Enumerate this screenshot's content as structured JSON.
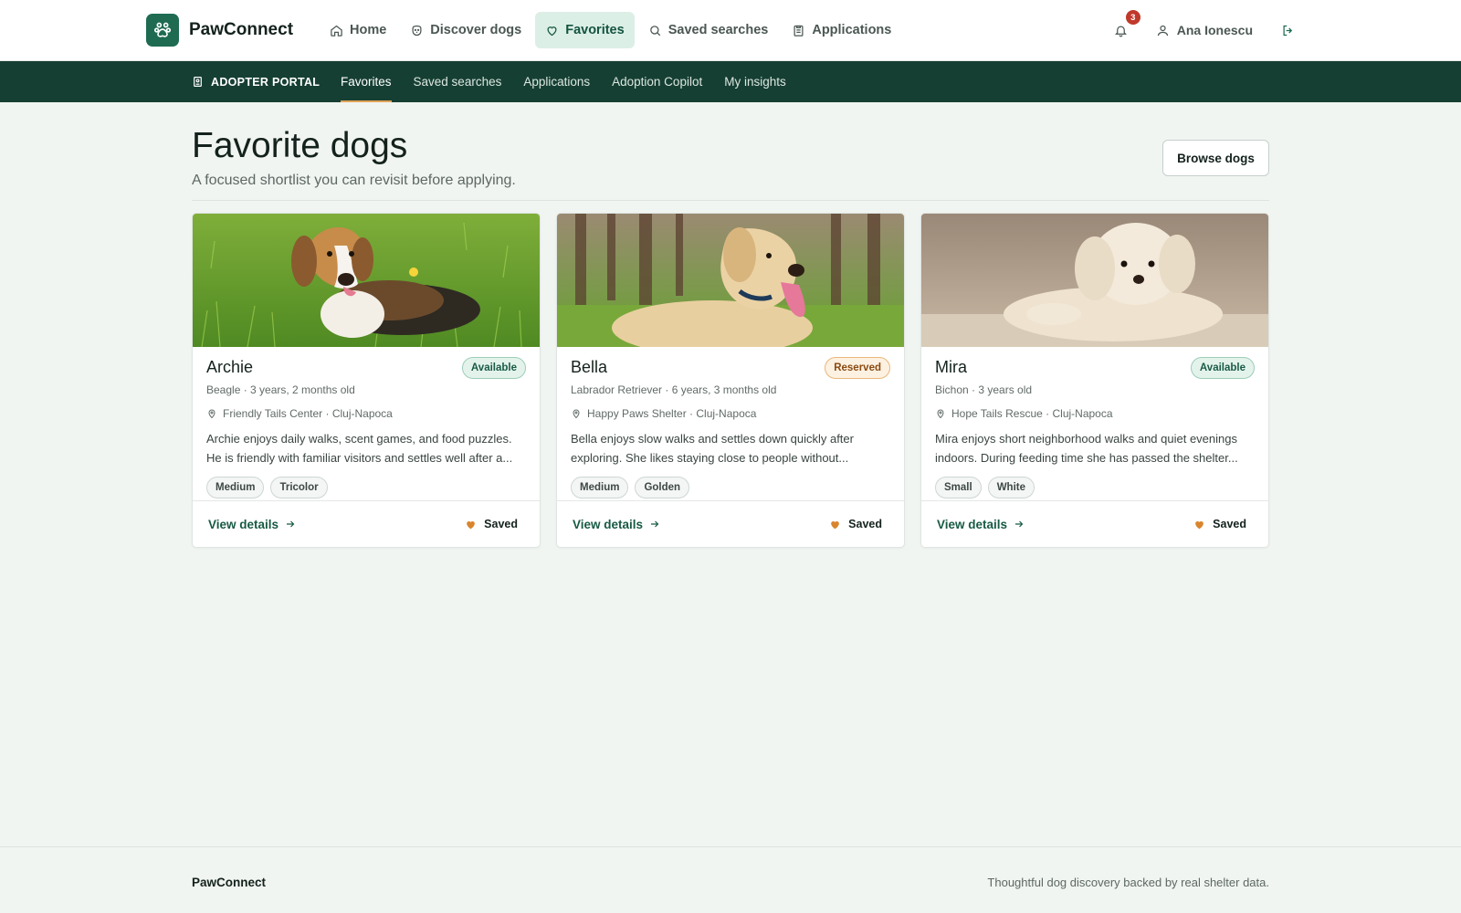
{
  "brand": {
    "name": "PawConnect"
  },
  "nav": {
    "items": [
      {
        "label": "Home",
        "icon": "home-icon"
      },
      {
        "label": "Discover dogs",
        "icon": "dog-icon"
      },
      {
        "label": "Favorites",
        "icon": "heart-icon",
        "active": true
      },
      {
        "label": "Saved searches",
        "icon": "search-icon"
      },
      {
        "label": "Applications",
        "icon": "clipboard-icon"
      }
    ],
    "notifications_count": "3",
    "user_name": "Ana Ionescu"
  },
  "subnav": {
    "portal_label": "ADOPTER PORTAL",
    "links": [
      {
        "label": "Favorites",
        "active": true
      },
      {
        "label": "Saved searches"
      },
      {
        "label": "Applications"
      },
      {
        "label": "Adoption Copilot"
      },
      {
        "label": "My insights"
      }
    ]
  },
  "page": {
    "title": "Favorite dogs",
    "subtitle": "A focused shortlist you can revisit before applying.",
    "browse_label": "Browse dogs"
  },
  "cards": [
    {
      "name": "Archie",
      "status": "Available",
      "meta": "Beagle · 3 years, 2 months old",
      "location": "Friendly Tails Center · Cluj-Napoca",
      "description": "Archie enjoys daily walks, scent games, and food puzzles. He is friendly with familiar visitors and settles well after a...",
      "tags": [
        "Medium",
        "Tricolor"
      ],
      "view_label": "View details",
      "saved_label": "Saved"
    },
    {
      "name": "Bella",
      "status": "Reserved",
      "meta": "Labrador Retriever · 6 years, 3 months old",
      "location": "Happy Paws Shelter · Cluj-Napoca",
      "description": "Bella enjoys slow walks and settles down quickly after exploring. She likes staying close to people without...",
      "tags": [
        "Medium",
        "Golden"
      ],
      "view_label": "View details",
      "saved_label": "Saved"
    },
    {
      "name": "Mira",
      "status": "Available",
      "meta": "Bichon · 3 years old",
      "location": "Hope Tails Rescue · Cluj-Napoca",
      "description": "Mira enjoys short neighborhood walks and quiet evenings indoors. During feeding time she has passed the shelter...",
      "tags": [
        "Small",
        "White"
      ],
      "view_label": "View details",
      "saved_label": "Saved"
    }
  ],
  "footer": {
    "brand": "PawConnect",
    "tagline": "Thoughtful dog discovery backed by real shelter data."
  },
  "colors": {
    "brand": "#1e6b52",
    "subnav_bg": "#163f33",
    "accent": "#e0a45a",
    "saved_heart": "#d9852e"
  }
}
